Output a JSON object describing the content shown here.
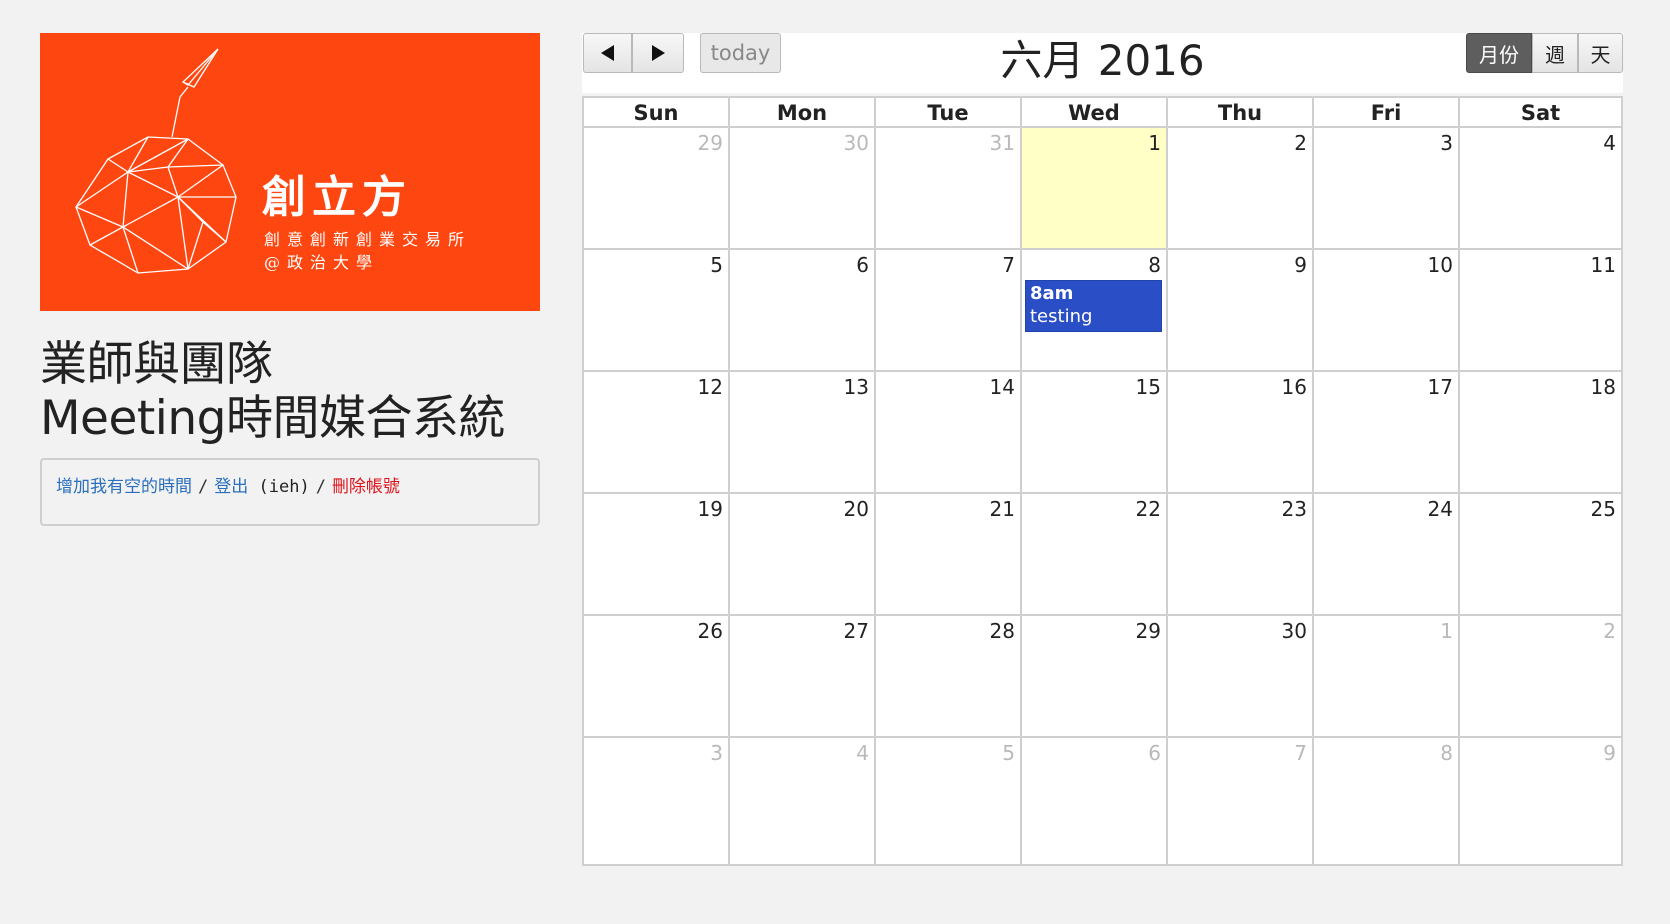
{
  "logo": {
    "title": "創立方",
    "subtitle_line1": "創意創新創業交易所",
    "subtitle_line2": "@政治大學",
    "background": "#fe4611"
  },
  "page_title_line1": "業師與團隊",
  "page_title_line2": "Meeting時間媒合系統",
  "actions": {
    "add_time": "增加我有空的時間",
    "separator": "/",
    "logout": "登出",
    "username": "(ieh)",
    "delete_account": "刪除帳號"
  },
  "calendar": {
    "prev_icon": "triangle-left-icon",
    "next_icon": "triangle-right-icon",
    "today_label": "today",
    "title": "六月 2016",
    "views": {
      "month": "月份",
      "week": "週",
      "day": "天"
    },
    "active_view": "month",
    "weekdays": [
      "Sun",
      "Mon",
      "Tue",
      "Wed",
      "Thu",
      "Fri",
      "Sat"
    ],
    "weeks": [
      [
        {
          "d": "29",
          "o": true
        },
        {
          "d": "30",
          "o": true
        },
        {
          "d": "31",
          "o": true
        },
        {
          "d": "1",
          "t": true
        },
        {
          "d": "2"
        },
        {
          "d": "3"
        },
        {
          "d": "4"
        }
      ],
      [
        {
          "d": "5"
        },
        {
          "d": "6"
        },
        {
          "d": "7"
        },
        {
          "d": "8"
        },
        {
          "d": "9"
        },
        {
          "d": "10"
        },
        {
          "d": "11"
        }
      ],
      [
        {
          "d": "12"
        },
        {
          "d": "13"
        },
        {
          "d": "14"
        },
        {
          "d": "15"
        },
        {
          "d": "16"
        },
        {
          "d": "17"
        },
        {
          "d": "18"
        }
      ],
      [
        {
          "d": "19"
        },
        {
          "d": "20"
        },
        {
          "d": "21"
        },
        {
          "d": "22"
        },
        {
          "d": "23"
        },
        {
          "d": "24"
        },
        {
          "d": "25"
        }
      ],
      [
        {
          "d": "26"
        },
        {
          "d": "27"
        },
        {
          "d": "28"
        },
        {
          "d": "29"
        },
        {
          "d": "30"
        },
        {
          "d": "1",
          "o": true
        },
        {
          "d": "2",
          "o": true
        }
      ],
      [
        {
          "d": "3",
          "o": true
        },
        {
          "d": "4",
          "o": true
        },
        {
          "d": "5",
          "o": true
        },
        {
          "d": "6",
          "o": true
        },
        {
          "d": "7",
          "o": true
        },
        {
          "d": "8",
          "o": true
        },
        {
          "d": "9",
          "o": true
        }
      ]
    ],
    "events": [
      {
        "date": "8",
        "time": "8am",
        "title": "testing",
        "color": "#2a4ec6"
      }
    ],
    "today_highlight_color": "#ffffc6"
  }
}
